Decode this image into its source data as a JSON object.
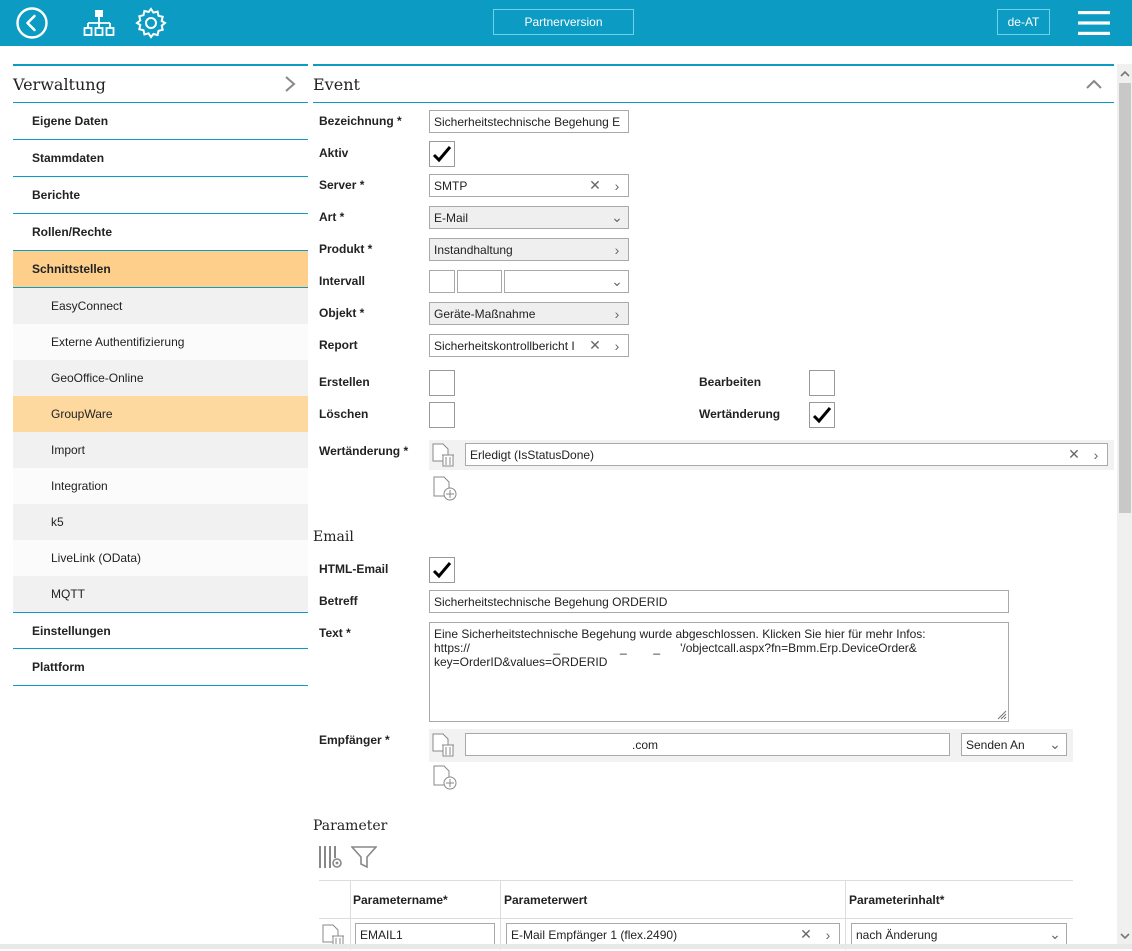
{
  "topbar": {
    "back_icon": "back-circle-icon",
    "sitemap_icon": "sitemap-icon",
    "settings_icon": "gear-icon",
    "partner_label": "Partnerversion",
    "language_label": "de-AT",
    "menu_icon": "hamburger-icon"
  },
  "sidebar": {
    "title": "Verwaltung",
    "items": [
      {
        "label": "Eigene Daten"
      },
      {
        "label": "Stammdaten"
      },
      {
        "label": "Berichte"
      },
      {
        "label": "Rollen/Rechte"
      },
      {
        "label": "Schnittstellen"
      }
    ],
    "subitems": [
      {
        "label": "EasyConnect"
      },
      {
        "label": "Externe Authentifizierung"
      },
      {
        "label": "GeoOffice-Online"
      },
      {
        "label": "GroupWare"
      },
      {
        "label": "Import"
      },
      {
        "label": "Integration"
      },
      {
        "label": "k5"
      },
      {
        "label": "LiveLink (OData)"
      },
      {
        "label": "MQTT"
      }
    ],
    "bottom_items": [
      {
        "label": "Einstellungen"
      },
      {
        "label": "Plattform"
      }
    ]
  },
  "event": {
    "title": "Event",
    "bezeichnung_label": "Bezeichnung *",
    "bezeichnung_value": "Sicherheitstechnische Begehung E",
    "aktiv_label": "Aktiv",
    "server_label": "Server *",
    "server_value": "SMTP",
    "art_label": "Art *",
    "art_value": "E-Mail",
    "produkt_label": "Produkt *",
    "produkt_value": "Instandhaltung",
    "intervall_label": "Intervall",
    "objekt_label": "Objekt *",
    "objekt_value": "Geräte-Maßnahme",
    "report_label": "Report",
    "report_value": "Sicherheitskontrollbericht I",
    "erstellen_label": "Erstellen",
    "bearbeiten_label": "Bearbeiten",
    "loeschen_label": "Löschen",
    "wertaenderung_label": "Wertänderung",
    "wertaenderung_req_label": "Wertänderung *",
    "wertaenderung_value": "Erledigt (IsStatusDone)"
  },
  "email": {
    "title": "Email",
    "html_label": "HTML-Email",
    "betreff_label": "Betreff",
    "betreff_value": "Sicherheitstechnische Begehung ORDERID",
    "text_label": "Text *",
    "text_line1": "Eine Sicherheitstechnische Begehung wurde abgeschlossen. Klicken Sie hier für mehr Infos:",
    "text_line2": "https://                         _                  _        _      '/objectcall.aspx?fn=Bmm.Erp.DeviceOrder&",
    "text_line3": "key=OrderID&values=ORDERID",
    "empfaenger_label": "Empfänger *",
    "empfaenger_value": ".com",
    "senden_value": "Senden An"
  },
  "parameter": {
    "title": "Parameter",
    "col_name": "Parametername*",
    "col_wert": "Parameterwert",
    "col_inhalt": "Parameterinhalt*",
    "rows": [
      {
        "name": "EMAIL1",
        "wert": "E-Mail Empfänger 1 (flex.2490)",
        "inhalt": "nach Änderung"
      }
    ]
  }
}
